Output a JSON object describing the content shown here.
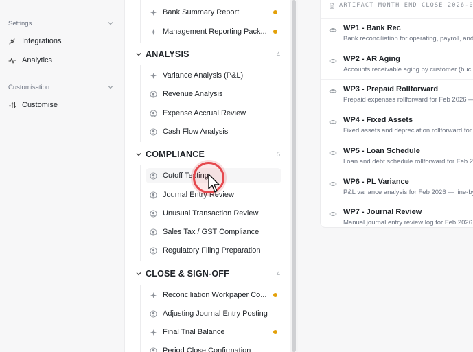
{
  "leftnav": {
    "settings_label": "Settings",
    "integrations_label": "Integrations",
    "analytics_label": "Analytics",
    "customisation_label": "Customisation",
    "customise_label": "Customise"
  },
  "tree": {
    "top_items": [
      {
        "label": "Bank Summary Report",
        "icon": "sparkle-icon",
        "status_dot": true
      },
      {
        "label": "Management Reporting Pack...",
        "icon": "sparkle-icon",
        "status_dot": true
      }
    ],
    "groups": [
      {
        "title": "ANALYSIS",
        "count": "4",
        "items": [
          {
            "label": "Variance Analysis (P&L)",
            "icon": "sparkle-icon",
            "status_dot": false
          },
          {
            "label": "Revenue Analysis",
            "icon": "person-icon",
            "status_dot": false
          },
          {
            "label": "Expense Accrual Review",
            "icon": "person-icon",
            "status_dot": false
          },
          {
            "label": "Cash Flow Analysis",
            "icon": "person-icon",
            "status_dot": false
          }
        ]
      },
      {
        "title": "COMPLIANCE",
        "count": "5",
        "items": [
          {
            "label": "Cutoff Testing",
            "icon": "person-icon",
            "status_dot": false
          },
          {
            "label": "Journal Entry Review",
            "icon": "person-icon",
            "status_dot": false
          },
          {
            "label": "Unusual Transaction Review",
            "icon": "person-icon",
            "status_dot": false
          },
          {
            "label": "Sales Tax / GST Compliance",
            "icon": "person-icon",
            "status_dot": false
          },
          {
            "label": "Regulatory Filing Preparation",
            "icon": "person-icon",
            "status_dot": false
          }
        ]
      },
      {
        "title": "CLOSE & SIGN-OFF",
        "count": "4",
        "items": [
          {
            "label": "Reconciliation Workpaper Co...",
            "icon": "sparkle-icon",
            "status_dot": true
          },
          {
            "label": "Adjusting Journal Entry Posting",
            "icon": "person-icon",
            "status_dot": false
          },
          {
            "label": "Final Trial Balance",
            "icon": "sparkle-icon",
            "status_dot": true
          },
          {
            "label": "Period Close Confirmation",
            "icon": "person-icon",
            "status_dot": false
          }
        ]
      }
    ],
    "status_dot_color": "#e3a008"
  },
  "artifact": {
    "header": "ARTIFACT_MONTH_END_CLOSE_2026-0",
    "workpapers": [
      {
        "title": "WP1 - Bank Rec",
        "desc": "Bank reconciliation for operating, payroll, and"
      },
      {
        "title": "WP2 - AR Aging",
        "desc": "Accounts receivable aging by customer (buc"
      },
      {
        "title": "WP3 - Prepaid Rollforward",
        "desc": "Prepaid expenses rollforward for Feb 2026 —"
      },
      {
        "title": "WP4 - Fixed Assets",
        "desc": "Fixed assets and depreciation rollforward for"
      },
      {
        "title": "WP5 - Loan Schedule",
        "desc": "Loan and debt schedule rollforward for Feb 20"
      },
      {
        "title": "WP6 - PL Variance",
        "desc": "P&L variance analysis for Feb 2026 — line-by"
      },
      {
        "title": "WP7 - Journal Review",
        "desc": "Manual journal entry review log for Feb 2026"
      }
    ]
  },
  "colors": {
    "accent_click": "#e5484d",
    "status_dot": "#e3a008"
  }
}
